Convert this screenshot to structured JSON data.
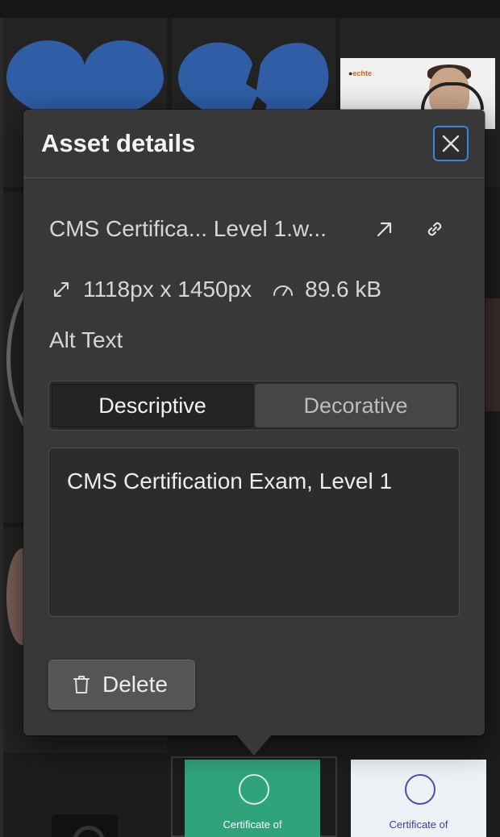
{
  "modal": {
    "title": "Asset details",
    "filename": "CMS Certifica... Level 1.w...",
    "dimensions": "1118px x 1450px",
    "file_size": "89.6 kB",
    "alt_text_label": "Alt Text",
    "alt_mode_options": [
      "Descriptive",
      "Decorative"
    ],
    "alt_mode_selected": "Descriptive",
    "alt_text_value": "CMS Certification Exam, Level 1",
    "delete_label": "Delete"
  },
  "background": {
    "webcam_brand": "echte",
    "certificate_titles": [
      "Certificate of",
      "Certificate of"
    ]
  },
  "colors": {
    "modal_bg": "#383838",
    "page_bg": "#1c1c1c",
    "focus_ring": "#3a86d6",
    "tile_blue": "#2f5ea6",
    "cert_green": "#2fa37a"
  },
  "icons": {
    "close": "close-icon",
    "open": "arrow-up-right-icon",
    "link": "link-icon",
    "dimensions": "resize-diagonal-icon",
    "size": "gauge-icon",
    "delete": "trash-icon"
  }
}
